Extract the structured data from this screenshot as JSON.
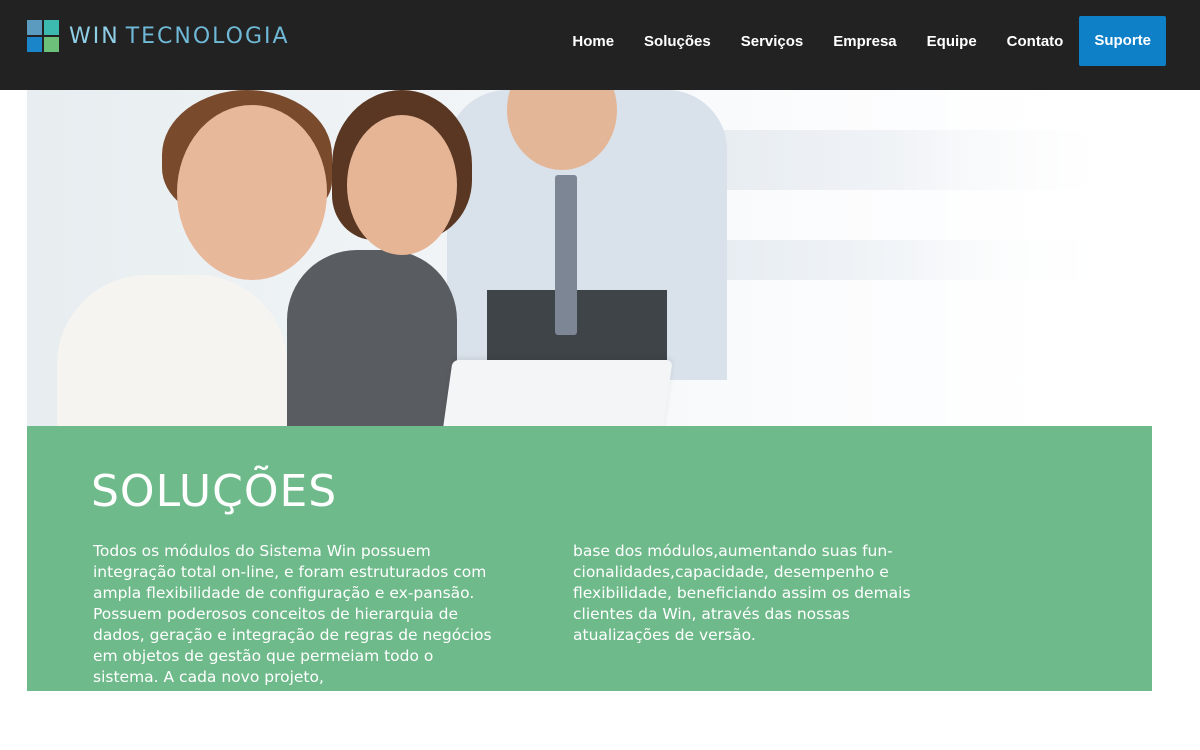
{
  "header": {
    "logo": {
      "word1": "WIN",
      "word2": "TECNOLOGIA",
      "icon": "four-squares-logo-icon"
    },
    "nav": [
      {
        "label": "Home"
      },
      {
        "label": "Soluções"
      },
      {
        "label": "Serviços"
      },
      {
        "label": "Empresa"
      },
      {
        "label": "Equipe"
      },
      {
        "label": "Contato"
      }
    ],
    "cta_label": "Suporte"
  },
  "hero": {
    "image": "team-working-at-laptop-photo"
  },
  "solutions": {
    "title": "SOLUÇÕES",
    "paragraph_col1": "Todos os módulos do Sistema Win possuem integração total on-line, e foram estruturados com ampla flexibilidade de configuração e ex-pansão. Possuem poderosos conceitos de hierarquia de dados, geração e integração de regras de negócios em objetos de gestão que permeiam todo o sistema. A cada novo projeto,",
    "paragraph_col2": "base dos módulos,aumentando suas fun-cionalidades,capacidade, desempenho e flexibilidade, beneficiando assim os demais clientes da Win,  através das nossas atualizações de versão."
  },
  "colors": {
    "navbar_bg": "#222222",
    "cta_bg": "#0e80c8",
    "section_bg": "#6fba8b",
    "text_light": "#ffffff"
  }
}
